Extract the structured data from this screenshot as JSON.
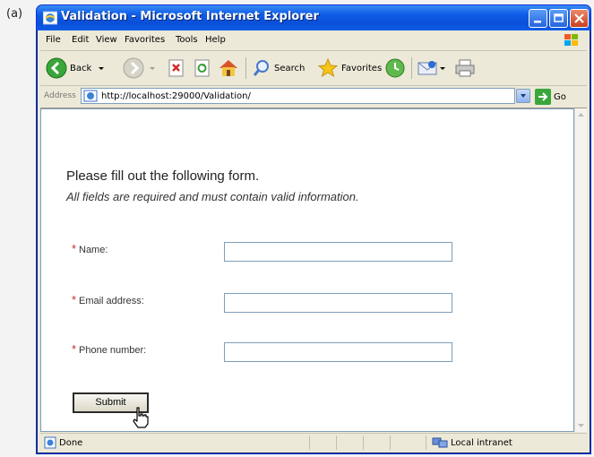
{
  "figure_label": "(a)",
  "window": {
    "title": "Validation - Microsoft Internet Explorer"
  },
  "menu": [
    "File",
    "Edit",
    "View",
    "Favorites",
    "Tools",
    "Help"
  ],
  "toolbar": {
    "back_label": "Back",
    "search_label": "Search",
    "favorites_label": "Favorites"
  },
  "address": {
    "label": "Address",
    "url": "http://localhost:29000/Validation/",
    "go_label": "Go"
  },
  "form": {
    "heading": "Please fill out the following form.",
    "subheading": "All fields are required and must contain valid information.",
    "required_mark": "*",
    "fields": [
      {
        "label": "Name:",
        "value": ""
      },
      {
        "label": "Email address:",
        "value": ""
      },
      {
        "label": "Phone number:",
        "value": ""
      }
    ],
    "submit_label": "Submit"
  },
  "status": {
    "left": "Done",
    "right": "Local intranet"
  },
  "colors": {
    "titlebar": "#0a4fd8",
    "required": "#c62b2b",
    "chrome": "#ece9d8"
  }
}
